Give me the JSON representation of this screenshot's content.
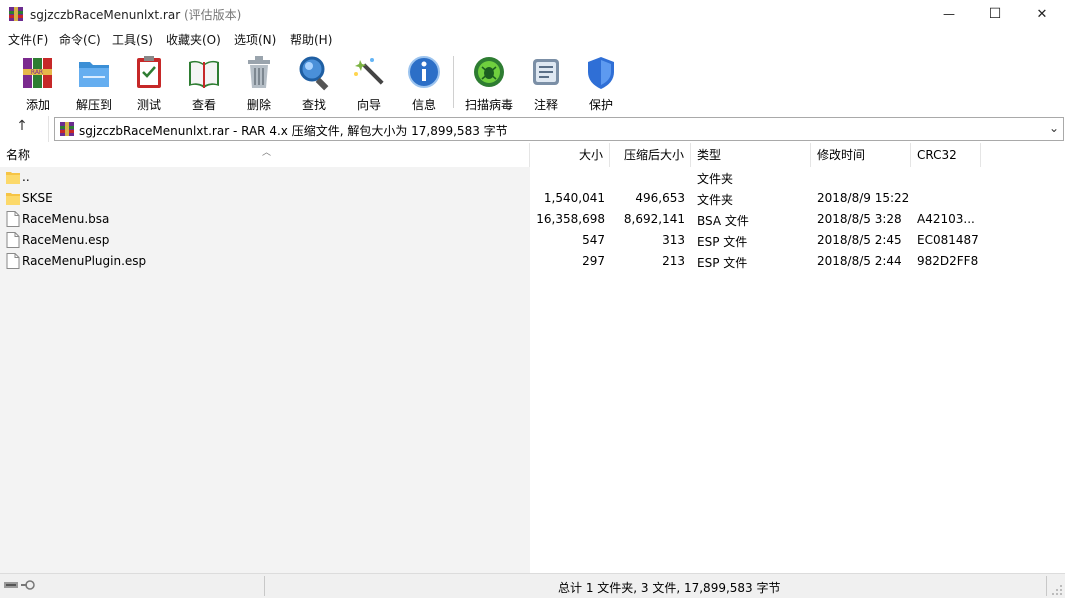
{
  "window": {
    "title": "sgjzczbRaceMenunlxt.rar",
    "title_suffix": "(评估版本)",
    "minimize": "—",
    "maximize": "☐",
    "close": "✕"
  },
  "menu": [
    "文件(F)",
    "命令(C)",
    "工具(S)",
    "收藏夹(O)",
    "选项(N)",
    "帮助(H)"
  ],
  "toolbar": {
    "add": "添加",
    "extract": "解压到",
    "test": "测试",
    "view": "查看",
    "delete": "删除",
    "find": "查找",
    "wizard": "向导",
    "info": "信息",
    "virus_scan": "扫描病毒",
    "comment": "注释",
    "protect": "保护"
  },
  "address": {
    "up": "↑",
    "text": "sgjzczbRaceMenunlxt.rar - RAR 4.x 压缩文件, 解包大小为 17,899,583 字节",
    "dropdown": "⌄"
  },
  "columns": {
    "name": "名称",
    "size": "大小",
    "packed": "压缩后大小",
    "type": "类型",
    "modified": "修改时间",
    "crc": "CRC32"
  },
  "rows": [
    {
      "name": "..",
      "size": "",
      "packed": "",
      "type": "文件夹",
      "modified": "",
      "crc": "",
      "icon": "folder-icon"
    },
    {
      "name": "SKSE",
      "size": "1,540,041",
      "packed": "496,653",
      "type": "文件夹",
      "modified": "2018/8/9 15:22",
      "crc": "",
      "icon": "folder-icon"
    },
    {
      "name": "RaceMenu.bsa",
      "size": "16,358,698",
      "packed": "8,692,141",
      "type": "BSA 文件",
      "modified": "2018/8/5 3:28",
      "crc": "A42103...",
      "icon": "file-icon"
    },
    {
      "name": "RaceMenu.esp",
      "size": "547",
      "packed": "313",
      "type": "ESP 文件",
      "modified": "2018/8/5 2:45",
      "crc": "EC081487",
      "icon": "file-icon"
    },
    {
      "name": "RaceMenuPlugin.esp",
      "size": "297",
      "packed": "213",
      "type": "ESP 文件",
      "modified": "2018/8/5 2:44",
      "crc": "982D2FF8",
      "icon": "file-icon"
    }
  ],
  "status": {
    "summary": "总计 1 文件夹, 3 文件, 17,899,583 字节"
  }
}
